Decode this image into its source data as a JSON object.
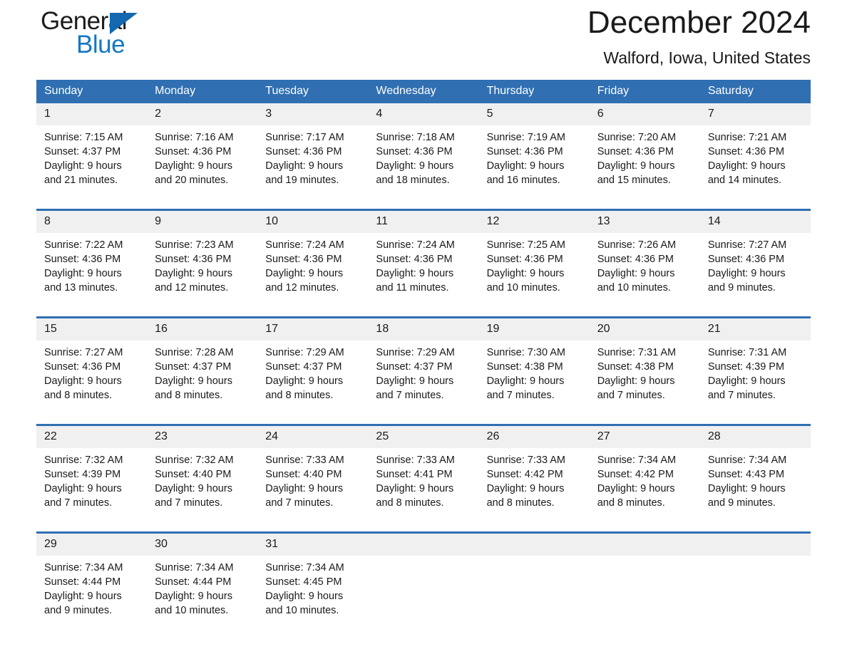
{
  "brand": {
    "name_part1": "General",
    "name_part2": "Blue",
    "logo_icon": "triangle-logo-icon"
  },
  "header": {
    "title": "December 2024",
    "subtitle": "Walford, Iowa, United States"
  },
  "colors": {
    "header_blue": "#2f6fb2",
    "brand_blue": "#1577c4",
    "daynum_band": "#f0f0f0",
    "text": "#1a1a1a"
  },
  "weekday_headers": [
    "Sunday",
    "Monday",
    "Tuesday",
    "Wednesday",
    "Thursday",
    "Friday",
    "Saturday"
  ],
  "weeks": [
    {
      "days": [
        {
          "date": "1",
          "sunrise": "Sunrise: 7:15 AM",
          "sunset": "Sunset: 4:37 PM",
          "daylight1": "Daylight: 9 hours",
          "daylight2": "and 21 minutes."
        },
        {
          "date": "2",
          "sunrise": "Sunrise: 7:16 AM",
          "sunset": "Sunset: 4:36 PM",
          "daylight1": "Daylight: 9 hours",
          "daylight2": "and 20 minutes."
        },
        {
          "date": "3",
          "sunrise": "Sunrise: 7:17 AM",
          "sunset": "Sunset: 4:36 PM",
          "daylight1": "Daylight: 9 hours",
          "daylight2": "and 19 minutes."
        },
        {
          "date": "4",
          "sunrise": "Sunrise: 7:18 AM",
          "sunset": "Sunset: 4:36 PM",
          "daylight1": "Daylight: 9 hours",
          "daylight2": "and 18 minutes."
        },
        {
          "date": "5",
          "sunrise": "Sunrise: 7:19 AM",
          "sunset": "Sunset: 4:36 PM",
          "daylight1": "Daylight: 9 hours",
          "daylight2": "and 16 minutes."
        },
        {
          "date": "6",
          "sunrise": "Sunrise: 7:20 AM",
          "sunset": "Sunset: 4:36 PM",
          "daylight1": "Daylight: 9 hours",
          "daylight2": "and 15 minutes."
        },
        {
          "date": "7",
          "sunrise": "Sunrise: 7:21 AM",
          "sunset": "Sunset: 4:36 PM",
          "daylight1": "Daylight: 9 hours",
          "daylight2": "and 14 minutes."
        }
      ]
    },
    {
      "days": [
        {
          "date": "8",
          "sunrise": "Sunrise: 7:22 AM",
          "sunset": "Sunset: 4:36 PM",
          "daylight1": "Daylight: 9 hours",
          "daylight2": "and 13 minutes."
        },
        {
          "date": "9",
          "sunrise": "Sunrise: 7:23 AM",
          "sunset": "Sunset: 4:36 PM",
          "daylight1": "Daylight: 9 hours",
          "daylight2": "and 12 minutes."
        },
        {
          "date": "10",
          "sunrise": "Sunrise: 7:24 AM",
          "sunset": "Sunset: 4:36 PM",
          "daylight1": "Daylight: 9 hours",
          "daylight2": "and 12 minutes."
        },
        {
          "date": "11",
          "sunrise": "Sunrise: 7:24 AM",
          "sunset": "Sunset: 4:36 PM",
          "daylight1": "Daylight: 9 hours",
          "daylight2": "and 11 minutes."
        },
        {
          "date": "12",
          "sunrise": "Sunrise: 7:25 AM",
          "sunset": "Sunset: 4:36 PM",
          "daylight1": "Daylight: 9 hours",
          "daylight2": "and 10 minutes."
        },
        {
          "date": "13",
          "sunrise": "Sunrise: 7:26 AM",
          "sunset": "Sunset: 4:36 PM",
          "daylight1": "Daylight: 9 hours",
          "daylight2": "and 10 minutes."
        },
        {
          "date": "14",
          "sunrise": "Sunrise: 7:27 AM",
          "sunset": "Sunset: 4:36 PM",
          "daylight1": "Daylight: 9 hours",
          "daylight2": "and 9 minutes."
        }
      ]
    },
    {
      "days": [
        {
          "date": "15",
          "sunrise": "Sunrise: 7:27 AM",
          "sunset": "Sunset: 4:36 PM",
          "daylight1": "Daylight: 9 hours",
          "daylight2": "and 8 minutes."
        },
        {
          "date": "16",
          "sunrise": "Sunrise: 7:28 AM",
          "sunset": "Sunset: 4:37 PM",
          "daylight1": "Daylight: 9 hours",
          "daylight2": "and 8 minutes."
        },
        {
          "date": "17",
          "sunrise": "Sunrise: 7:29 AM",
          "sunset": "Sunset: 4:37 PM",
          "daylight1": "Daylight: 9 hours",
          "daylight2": "and 8 minutes."
        },
        {
          "date": "18",
          "sunrise": "Sunrise: 7:29 AM",
          "sunset": "Sunset: 4:37 PM",
          "daylight1": "Daylight: 9 hours",
          "daylight2": "and 7 minutes."
        },
        {
          "date": "19",
          "sunrise": "Sunrise: 7:30 AM",
          "sunset": "Sunset: 4:38 PM",
          "daylight1": "Daylight: 9 hours",
          "daylight2": "and 7 minutes."
        },
        {
          "date": "20",
          "sunrise": "Sunrise: 7:31 AM",
          "sunset": "Sunset: 4:38 PM",
          "daylight1": "Daylight: 9 hours",
          "daylight2": "and 7 minutes."
        },
        {
          "date": "21",
          "sunrise": "Sunrise: 7:31 AM",
          "sunset": "Sunset: 4:39 PM",
          "daylight1": "Daylight: 9 hours",
          "daylight2": "and 7 minutes."
        }
      ]
    },
    {
      "days": [
        {
          "date": "22",
          "sunrise": "Sunrise: 7:32 AM",
          "sunset": "Sunset: 4:39 PM",
          "daylight1": "Daylight: 9 hours",
          "daylight2": "and 7 minutes."
        },
        {
          "date": "23",
          "sunrise": "Sunrise: 7:32 AM",
          "sunset": "Sunset: 4:40 PM",
          "daylight1": "Daylight: 9 hours",
          "daylight2": "and 7 minutes."
        },
        {
          "date": "24",
          "sunrise": "Sunrise: 7:33 AM",
          "sunset": "Sunset: 4:40 PM",
          "daylight1": "Daylight: 9 hours",
          "daylight2": "and 7 minutes."
        },
        {
          "date": "25",
          "sunrise": "Sunrise: 7:33 AM",
          "sunset": "Sunset: 4:41 PM",
          "daylight1": "Daylight: 9 hours",
          "daylight2": "and 8 minutes."
        },
        {
          "date": "26",
          "sunrise": "Sunrise: 7:33 AM",
          "sunset": "Sunset: 4:42 PM",
          "daylight1": "Daylight: 9 hours",
          "daylight2": "and 8 minutes."
        },
        {
          "date": "27",
          "sunrise": "Sunrise: 7:34 AM",
          "sunset": "Sunset: 4:42 PM",
          "daylight1": "Daylight: 9 hours",
          "daylight2": "and 8 minutes."
        },
        {
          "date": "28",
          "sunrise": "Sunrise: 7:34 AM",
          "sunset": "Sunset: 4:43 PM",
          "daylight1": "Daylight: 9 hours",
          "daylight2": "and 9 minutes."
        }
      ]
    },
    {
      "days": [
        {
          "date": "29",
          "sunrise": "Sunrise: 7:34 AM",
          "sunset": "Sunset: 4:44 PM",
          "daylight1": "Daylight: 9 hours",
          "daylight2": "and 9 minutes."
        },
        {
          "date": "30",
          "sunrise": "Sunrise: 7:34 AM",
          "sunset": "Sunset: 4:44 PM",
          "daylight1": "Daylight: 9 hours",
          "daylight2": "and 10 minutes."
        },
        {
          "date": "31",
          "sunrise": "Sunrise: 7:34 AM",
          "sunset": "Sunset: 4:45 PM",
          "daylight1": "Daylight: 9 hours",
          "daylight2": "and 10 minutes."
        },
        {
          "date": "",
          "sunrise": "",
          "sunset": "",
          "daylight1": "",
          "daylight2": ""
        },
        {
          "date": "",
          "sunrise": "",
          "sunset": "",
          "daylight1": "",
          "daylight2": ""
        },
        {
          "date": "",
          "sunrise": "",
          "sunset": "",
          "daylight1": "",
          "daylight2": ""
        },
        {
          "date": "",
          "sunrise": "",
          "sunset": "",
          "daylight1": "",
          "daylight2": ""
        }
      ]
    }
  ]
}
